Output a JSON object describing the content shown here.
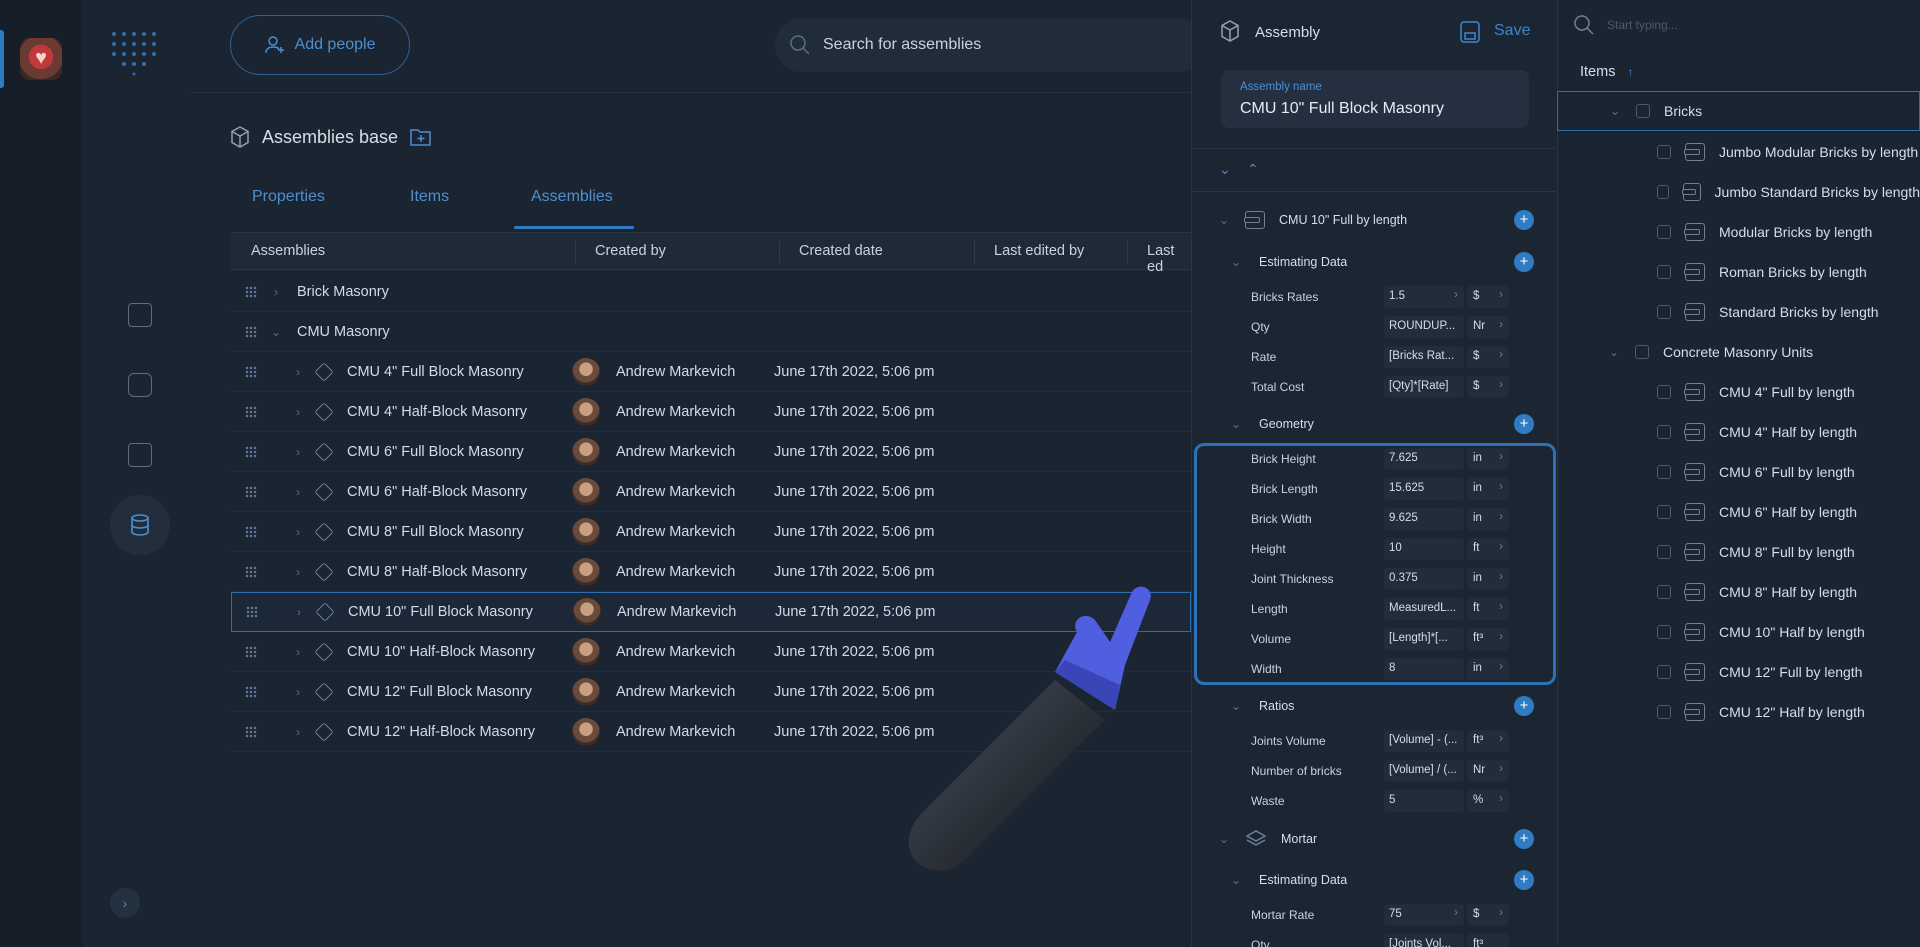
{
  "header": {
    "add_people_label": "Add people",
    "search_placeholder": "Search for assemblies"
  },
  "page": {
    "title": "Assemblies base",
    "tabs": [
      "Properties",
      "Items",
      "Assemblies"
    ],
    "active_tab": "Assemblies"
  },
  "table": {
    "columns": [
      "Assemblies",
      "Created by",
      "Created date",
      "Last edited by",
      "Last ed"
    ],
    "groups": [
      "Brick Masonry",
      "CMU Masonry"
    ],
    "rows": [
      {
        "name": "CMU 4\" Full Block Masonry",
        "created_by": "Andrew Markevich",
        "created_date": "June 17th 2022, 5:06 pm"
      },
      {
        "name": "CMU 4\" Half-Block Masonry",
        "created_by": "Andrew Markevich",
        "created_date": "June 17th 2022, 5:06 pm"
      },
      {
        "name": "CMU 6\" Full Block Masonry",
        "created_by": "Andrew Markevich",
        "created_date": "June 17th 2022, 5:06 pm"
      },
      {
        "name": "CMU 6\" Half-Block Masonry",
        "created_by": "Andrew Markevich",
        "created_date": "June 17th 2022, 5:06 pm"
      },
      {
        "name": "CMU 8\" Full Block Masonry",
        "created_by": "Andrew Markevich",
        "created_date": "June 17th 2022, 5:06 pm"
      },
      {
        "name": "CMU 8\" Half-Block Masonry",
        "created_by": "Andrew Markevich",
        "created_date": "June 17th 2022, 5:06 pm"
      },
      {
        "name": "CMU 10\" Full Block Masonry",
        "created_by": "Andrew Markevich",
        "created_date": "June 17th 2022, 5:06 pm"
      },
      {
        "name": "CMU 10\" Half-Block Masonry",
        "created_by": "Andrew Markevich",
        "created_date": "June 17th 2022, 5:06 pm"
      },
      {
        "name": "CMU 12\" Full Block Masonry",
        "created_by": "Andrew Markevich",
        "created_date": "June 17th 2022, 5:06 pm"
      },
      {
        "name": "CMU 12\" Half-Block Masonry",
        "created_by": "Andrew Markevich",
        "created_date": "June 17th 2022, 5:06 pm"
      }
    ]
  },
  "panel": {
    "title": "Assembly",
    "save_label": "Save",
    "name_label": "Assembly name",
    "name_value": "CMU 10\" Full Block Masonry",
    "item1_title": "CMU 10\" Full by length",
    "estimating_title": "Estimating Data",
    "estimating": [
      {
        "name": "Bricks Rates",
        "value": "1.5",
        "unit": "$"
      },
      {
        "name": "Qty",
        "value": "ROUNDUP...",
        "unit": "Nr"
      },
      {
        "name": "Rate",
        "value": "[Bricks Rat...",
        "unit": "$"
      },
      {
        "name": "Total Cost",
        "value": "[Qty]*[Rate]",
        "unit": "$"
      }
    ],
    "geometry_title": "Geometry",
    "geometry": [
      {
        "name": "Brick Height",
        "value": "7.625",
        "unit": "in"
      },
      {
        "name": "Brick Length",
        "value": "15.625",
        "unit": "in"
      },
      {
        "name": "Brick Width",
        "value": "9.625",
        "unit": "in"
      },
      {
        "name": "Height",
        "value": "10",
        "unit": "ft"
      },
      {
        "name": "Joint Thickness",
        "value": "0.375",
        "unit": "in"
      },
      {
        "name": "Length",
        "value": "MeasuredL...",
        "unit": "ft"
      },
      {
        "name": "Volume",
        "value": "[Length]*[...",
        "unit": "ft³"
      },
      {
        "name": "Width",
        "value": "8",
        "unit": "in"
      }
    ],
    "ratios_title": "Ratios",
    "ratios": [
      {
        "name": "Joints Volume",
        "value": "[Volume] - (...",
        "unit": "ft³"
      },
      {
        "name": "Number of bricks",
        "value": "[Volume] / (...",
        "unit": "Nr"
      },
      {
        "name": "Waste",
        "value": "5",
        "unit": "%"
      }
    ],
    "item2_title": "Mortar",
    "estimating2_title": "Estimating Data",
    "estimating2": [
      {
        "name": "Mortar Rate",
        "value": "75",
        "unit": "$"
      },
      {
        "name": "Qty",
        "value": "[Joints Vol...",
        "unit": "ft³"
      }
    ]
  },
  "tree": {
    "search_placeholder": "Start typing...",
    "header": "Items",
    "sort_icon": "↑",
    "groups": [
      {
        "label": "Bricks",
        "children": [
          "Jumbo Modular Bricks by length",
          "Jumbo Standard Bricks by length",
          "Modular Bricks by length",
          "Roman Bricks by length",
          "Standard Bricks by length"
        ]
      },
      {
        "label": "Concrete Masonry Units",
        "children": [
          "CMU 4\" Full by length",
          "CMU 4\" Half by length",
          "CMU 6\" Full by length",
          "CMU 6\" Half by length",
          "CMU 8\" Full by length",
          "CMU 8\" Half by length",
          "CMU 10\" Half by length",
          "CMU 12\" Full by length",
          "CMU 12\" Half by length"
        ]
      }
    ]
  },
  "colors": {
    "accent": "#2f7bc4",
    "background": "#182230",
    "panel": "#1c2633"
  }
}
